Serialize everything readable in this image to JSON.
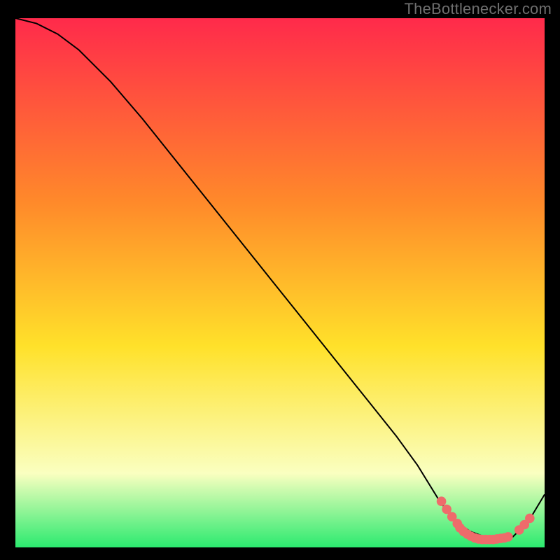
{
  "watermark": "TheBottlenecker.com",
  "colors": {
    "bg": "#000000",
    "gradient_top": "#ff2a4b",
    "gradient_mid1": "#ff8a2a",
    "gradient_mid2": "#ffe12a",
    "gradient_low": "#faffc0",
    "gradient_bottom": "#2bea6f",
    "curve": "#000000",
    "marker": "#ee6b6b"
  },
  "chart_data": {
    "type": "line",
    "title": "",
    "xlabel": "",
    "ylabel": "",
    "xlim": [
      0,
      100
    ],
    "ylim": [
      0,
      100
    ],
    "series": [
      {
        "name": "bottleneck-curve",
        "x": [
          0,
          4,
          8,
          12,
          18,
          24,
          30,
          36,
          42,
          48,
          54,
          60,
          66,
          72,
          76,
          80,
          83,
          86,
          90,
          94,
          97,
          100
        ],
        "y": [
          100,
          99,
          97,
          94,
          88,
          81,
          73.5,
          66,
          58.5,
          51,
          43.5,
          36,
          28.5,
          21,
          15.5,
          9,
          5,
          3,
          1.5,
          2,
          5,
          10
        ]
      }
    ],
    "markers": {
      "name": "highlight-dots",
      "x": [
        80.5,
        81.5,
        82.5,
        83.5,
        84,
        84.7,
        85.4,
        86.1,
        86.8,
        87.5,
        88.2,
        88.9,
        89.6,
        90.3,
        91,
        91.7,
        92.4,
        93.1,
        95.2,
        96.2,
        97.2
      ],
      "y": [
        8.7,
        7.2,
        5.8,
        4.5,
        3.7,
        3.0,
        2.5,
        2.1,
        1.8,
        1.6,
        1.5,
        1.5,
        1.5,
        1.5,
        1.6,
        1.7,
        1.8,
        2.0,
        3.3,
        4.3,
        5.5
      ]
    }
  }
}
